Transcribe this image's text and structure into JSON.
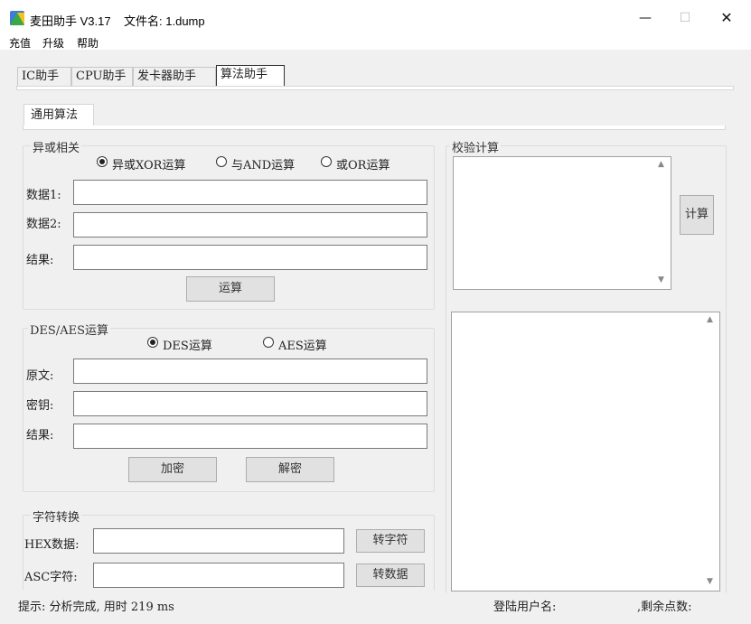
{
  "window": {
    "title": "麦田助手 V3.17    文件名: 1.dump",
    "minimize_glyph": "—",
    "maximize_glyph": "☐",
    "close_glyph": "✕"
  },
  "menu": [
    "充值",
    "升级",
    "帮助"
  ],
  "main_tabs": [
    "IC助手",
    "CPU助手",
    "发卡器助手",
    "算法助手"
  ],
  "sub_tabs": [
    "通用算法"
  ],
  "xor_group": {
    "title": "异或相关",
    "radios": [
      "异或XOR运算",
      "与AND运算",
      "或OR运算"
    ],
    "selected": "异或XOR运算",
    "labels": [
      "数据1:",
      "数据2:",
      "结果:"
    ],
    "values": [
      "",
      "",
      ""
    ],
    "button": "运算"
  },
  "des_group": {
    "title": "DES/AES运算",
    "radios": [
      "DES运算",
      "AES运算"
    ],
    "selected": "DES运算",
    "labels": [
      "原文:",
      "密钥:",
      "结果:"
    ],
    "values": [
      "",
      "",
      ""
    ],
    "encrypt_button": "加密",
    "decrypt_button": "解密"
  },
  "char_group": {
    "title": "字符转换",
    "labels": [
      "HEX数据:",
      "ASC字符:"
    ],
    "values": [
      "",
      ""
    ],
    "buttons": [
      "转字符",
      "转数据"
    ]
  },
  "checksum_group": {
    "title": "校验计算",
    "input": "",
    "button": "计算",
    "output": ""
  },
  "status": {
    "hint": "提示: 分析完成, 用时 219 ms",
    "user_label": "登陆用户名:",
    "points_label": ",剩余点数:"
  },
  "colors": {
    "titlebar": "#ffffff",
    "window_bg": "#f0f0f0",
    "button_bg": "#e1e1e1",
    "icon_green": "#3aa845",
    "icon_yellow": "#f4c21b",
    "icon_blue": "#3b7dd8"
  },
  "icons": {
    "app": "app-logo-icon",
    "scroll_up": "scroll-up-icon",
    "scroll_down": "scroll-down-icon"
  }
}
